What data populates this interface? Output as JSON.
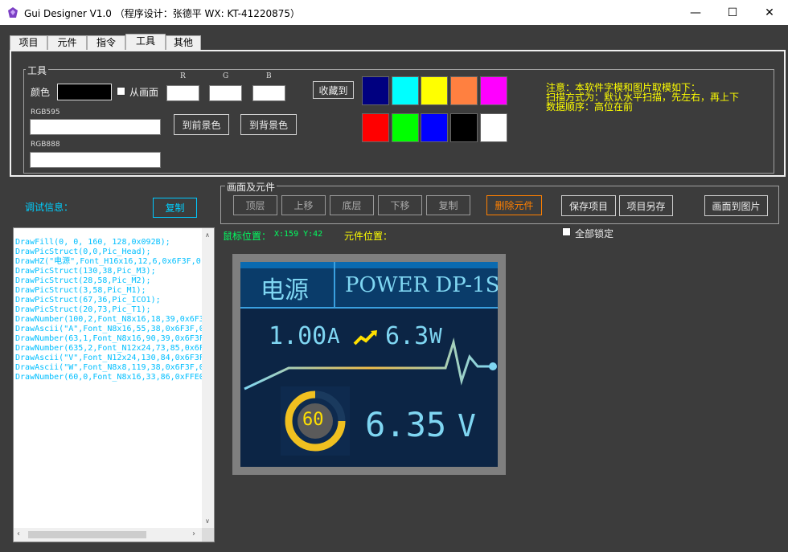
{
  "window": {
    "title": "Gui Designer V1.0 （程序设计：张德平 WX: KT-41220875）",
    "minimize": "—",
    "maximize": "☐",
    "close": "✕"
  },
  "tabs": [
    "项目",
    "元件",
    "指令",
    "工具",
    "其他"
  ],
  "tools": {
    "group_title": "工具",
    "color_label": "颜色",
    "from_screen_label": "从画面",
    "r_label": "R",
    "g_label": "G",
    "b_label": "B",
    "collect_button": "收藏到",
    "rgb595_label": "RGB595",
    "rgb888_label": "RGB888",
    "to_foreground_button": "到前景色",
    "to_background_button": "到背景色",
    "swatches": [
      "#000080",
      "#00ffff",
      "#ffff00",
      "#ff8040",
      "#ff00ff",
      "#ff0000",
      "#00ff00",
      "#0000ff",
      "#000000",
      "#ffffff"
    ],
    "notes": [
      "注意：本软件字模和图片取模如下：",
      "扫描方式为：默认水平扫描，先左右，再上下",
      "数据顺序：高位在前"
    ]
  },
  "debug": {
    "label": "调试信息：",
    "copy_button": "复制",
    "lines": [
      "DrawFill(0, 0, 160, 128,0x092B);",
      "DrawPicStruct(0,0,Pic_Head);",
      "DrawHZ(\"电源\",Font_H16x16,12,6,0x6F3F,0",
      "DrawPicStruct(130,38,Pic_M3);",
      "DrawPicStruct(28,58,Pic_M2);",
      "DrawPicStruct(3,58,Pic_M1);",
      "DrawPicStruct(67,36,Pic_ICO1);",
      "DrawPicStruct(20,73,Pic_T1);",
      "DrawNumber(100,2,Font_N8x16,18,39,0x6F3",
      "DrawAscii(\"A\",Font_N8x16,55,38,0x6F3F,0",
      "DrawNumber(63,1,Font_N8x16,90,39,0x6F3F",
      "DrawNumber(635,2,Font_N12x24,73,85,0x6F",
      "DrawAscii(\"V\",Font_N12x24,130,84,0x6F3F",
      "DrawAscii(\"W\",Font_N8x8,119,38,0x6F3F,0",
      "DrawNumber(60,0,Font_N8x16,33,86,0xFFE0"
    ]
  },
  "canvas": {
    "group_title": "画面及元件",
    "buttons": [
      "顶层",
      "上移",
      "底层",
      "下移",
      "复制",
      "删除元件",
      "保存项目",
      "项目另存",
      "画面到图片"
    ],
    "mouse_label": "鼠标位置：",
    "mouse_value": "X:159 Y:42",
    "element_label": "元件位置：",
    "lock_all_label": "全部锁定"
  },
  "lcd": {
    "title_cn": "电源",
    "title_en": "POWER DP-1S",
    "current": "1.00",
    "current_unit": "A",
    "power": "6.3",
    "power_unit": "W",
    "gauge_value": "60",
    "voltage": "6.35",
    "voltage_unit": "V"
  }
}
